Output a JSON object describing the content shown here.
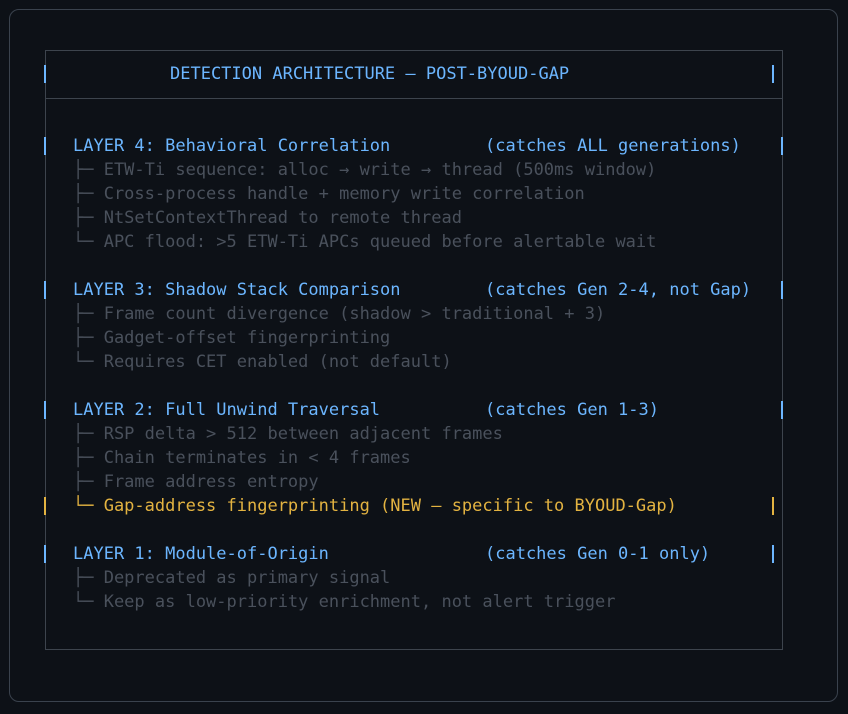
{
  "title": "DETECTION ARCHITECTURE — POST-BYOUD-GAP",
  "layers": [
    {
      "heading": "LAYER 4: Behavioral Correlation",
      "catches": "(catches ALL generations)",
      "items": [
        "├─ ETW-Ti sequence: alloc → write → thread (500ms window)",
        "├─ Cross-process handle + memory write correlation",
        "├─ NtSetContextThread to remote thread",
        "└─ APC flood: >5 ETW-Ti APCs queued before alertable wait"
      ]
    },
    {
      "heading": "LAYER 3: Shadow Stack Comparison",
      "catches": "(catches Gen 2-4, not Gap)",
      "items": [
        "├─ Frame count divergence (shadow > traditional + 3)",
        "├─ Gadget-offset fingerprinting",
        "└─ Requires CET enabled (not default)"
      ]
    },
    {
      "heading": "LAYER 2: Full Unwind Traversal",
      "catches": "(catches Gen 1-3)",
      "items": [
        "├─ RSP delta > 512 between adjacent frames",
        "├─ Chain terminates in < 4 frames",
        "├─ Frame address entropy"
      ],
      "highlight": "└─ Gap-address fingerprinting (NEW — specific to BYOUD-Gap)"
    },
    {
      "heading": "LAYER 1: Module-of-Origin",
      "catches": "(catches Gen 0-1 only)",
      "items": [
        "├─ Deprecated as primary signal",
        "└─ Keep as low-priority enrichment, not alert trigger"
      ]
    }
  ]
}
